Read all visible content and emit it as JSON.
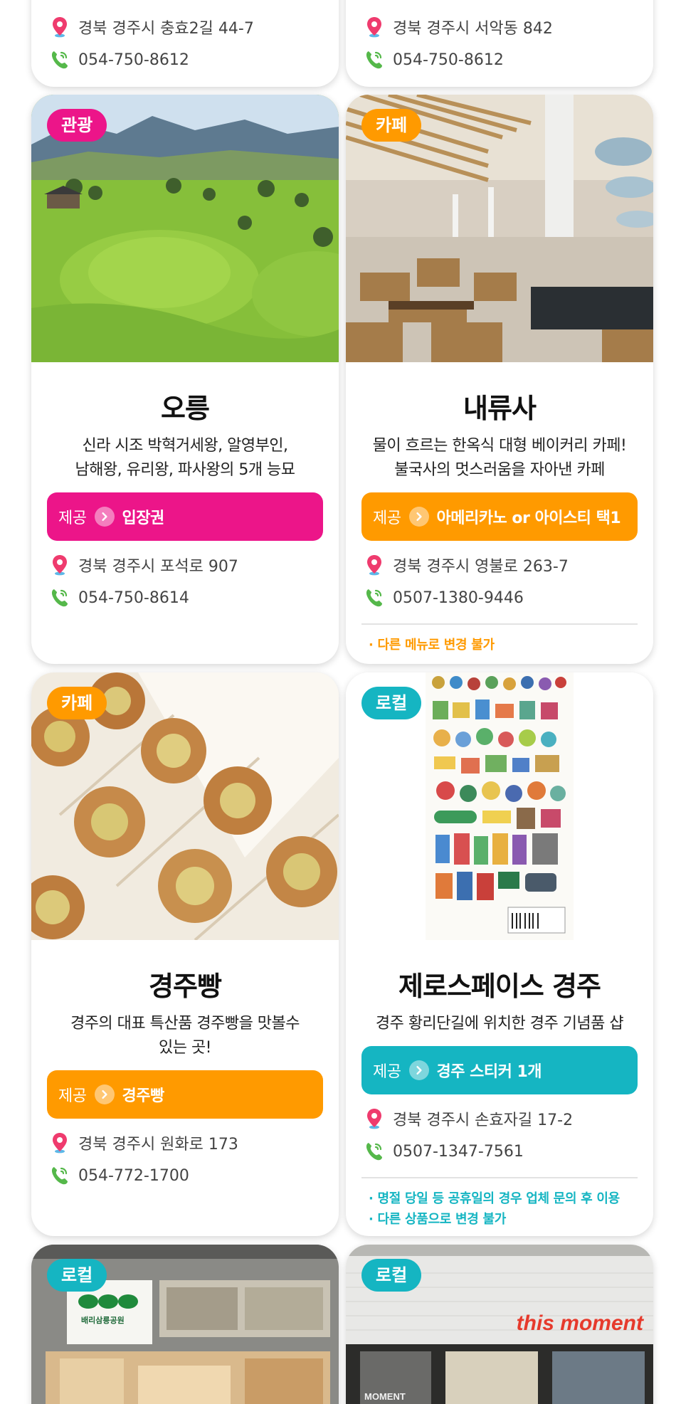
{
  "top_cards": [
    {
      "address": "경북 경주시 충효2길 44-7",
      "phone": "054-750-8612",
      "address_icon": "location-pin-icon",
      "phone_icon": "phone-icon"
    },
    {
      "address": "경북 경주시 서악동 842",
      "phone": "054-750-8612",
      "address_icon": "location-pin-icon",
      "phone_icon": "phone-icon"
    }
  ],
  "cards": [
    {
      "badge": "관광",
      "badge_color": "#ec1589",
      "title": "오릉",
      "desc_line1": "신라 시조 박혁거세왕, 알영부인,",
      "desc_line2": "남해왕, 유리왕, 파사왕의 5개 능묘",
      "offer_label": "제공",
      "offer_item": "입장권",
      "address": "경북 경주시 포석로 907",
      "phone": "054-750-8614"
    },
    {
      "badge": "카페",
      "badge_color": "#ff9a00",
      "title": "내류사",
      "desc_line1": "물이 흐르는 한옥식 대형 베이커리 카페!",
      "desc_line2": "불국사의 멋스러움을 자아낸 카페",
      "offer_label": "제공",
      "offer_item": "아메리카노 or 아이스티 택1",
      "address": "경북 경주시 영불로 263-7",
      "phone": "0507-1380-9446",
      "notes": [
        "· 다른 메뉴로 변경 불가"
      ]
    },
    {
      "badge": "카페",
      "badge_color": "#ff9a00",
      "title": "경주빵",
      "desc_line1": "경주의 대표 특산품 경주빵을 맛볼수",
      "desc_line2": "있는 곳!",
      "offer_label": "제공",
      "offer_item": "경주빵",
      "address": "경북 경주시 원화로 173",
      "phone": "054-772-1700"
    },
    {
      "badge": "로컬",
      "badge_color": "#15b5c2",
      "title": "제로스페이스 경주",
      "desc_line1": "경주 황리단길에 위치한 경주 기념품 샵",
      "offer_label": "제공",
      "offer_item": "경주 스티커 1개",
      "address": "경북 경주시 손효자길 17-2",
      "phone": "0507-1347-7561",
      "notes": [
        "· 명절 당일 등 공휴일의 경우 업체 문의 후 이용",
        "· 다른 상품으로 변경 불가"
      ]
    }
  ],
  "bottom_cards": [
    {
      "badge": "로컬",
      "sign_text": "배리삼릉공원"
    },
    {
      "badge": "로컬",
      "sign_text": "this moment",
      "storefront_text": "MOMENT"
    }
  ]
}
